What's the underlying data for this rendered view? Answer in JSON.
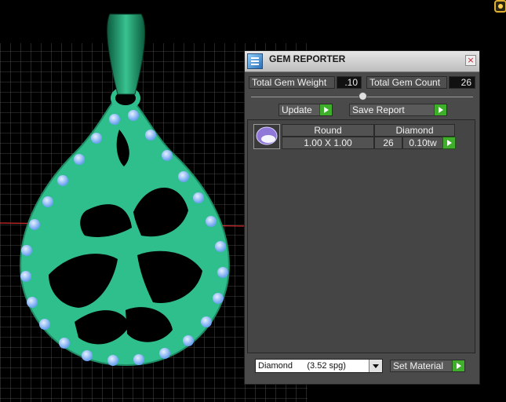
{
  "panel": {
    "title": "GEM REPORTER",
    "close_glyph": "×",
    "total_gem_weight_label": "Total Gem Weight",
    "total_gem_weight_value": ".10",
    "total_gem_count_label": "Total Gem Count",
    "total_gem_count_value": "26",
    "update_label": "Update",
    "save_report_label": "Save Report",
    "gem_row": {
      "shape": "Round",
      "material": "Diamond",
      "size": "1.00 X 1.00",
      "count": "26",
      "weight": "0.10tw"
    },
    "material_select_value": "Diamond      (3.52 spg)",
    "set_material_label": "Set Material"
  },
  "colors": {
    "pendant": "#2fbf8c",
    "gem": "#7fb4f5",
    "grid": "#7a7a7a",
    "accent_button": "#3fae2b"
  },
  "icons": [
    "gem-reporter-icon",
    "close-icon",
    "slider-knob",
    "play-arrow-icon",
    "dropdown-arrow-icon",
    "gem-thumbnail"
  ]
}
